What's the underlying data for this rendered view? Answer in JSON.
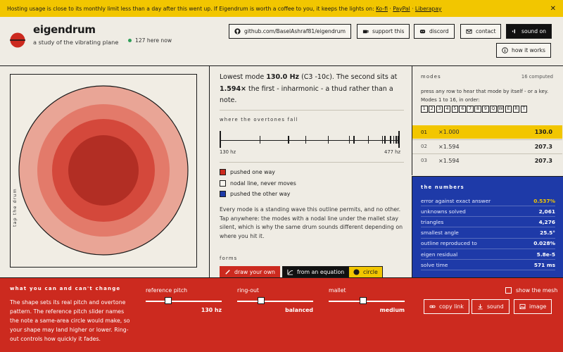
{
  "banner": {
    "message": "Hosting usage is close to its monthly limit less than a day after this went up. If Eigendrum is worth a coffee to you, it keeps the lights on:",
    "links": [
      "Ko-fi",
      "PayPal",
      "Liberapay"
    ],
    "separator": "·",
    "close": "✕"
  },
  "header": {
    "title": "eigendrum",
    "subtitle": "a study of the vibrating plane",
    "online": "127 here now",
    "buttons": {
      "github": "github.com/BaselAshraf81/eigendrum",
      "support": "support this",
      "discord": "discord",
      "contact": "contact",
      "sound": "sound on",
      "how": "how it works"
    }
  },
  "drum": {
    "tap_label": "tap the drum",
    "ring_colors": [
      "#e9a596",
      "#e37a6a",
      "#d4483b",
      "#b22e24"
    ]
  },
  "summary": {
    "p1": "Lowest mode ",
    "freq": "130.0 Hz",
    "p2": " (C3 -10c). The second sits at ",
    "ratio": "1.594×",
    "p3": " the first - inharmonic - a thud rather than a note."
  },
  "overtones": {
    "title": "where the overtones fall",
    "min_label": "130 hz",
    "max_label": "477 hz",
    "min_hz": 130,
    "max_hz": 477,
    "marks_hz": [
      130,
      207.3,
      207.3,
      263,
      296,
      340,
      381,
      390,
      418,
      445,
      450,
      461,
      467,
      472,
      475,
      477
    ],
    "legend": [
      {
        "label": "pushed one way",
        "color": "#cc2a1f"
      },
      {
        "label": "nodal line, never moves",
        "color": "#f7f5ef"
      },
      {
        "label": "pushed the other way",
        "color": "#1e3aa8"
      }
    ],
    "paragraph": "Every mode is a standing wave this outline permits, and no other. Tap anywhere: the modes with a nodal line under the mallet stay silent, which is why the same drum sounds different depending on where you hit it."
  },
  "forms": {
    "title": "forms",
    "draw": "draw your own",
    "equation": "from an equation",
    "circle": "circle"
  },
  "modes": {
    "title": "modes",
    "count": "16 computed",
    "hint": "press any row to hear that mode by itself - or a key. Modes 1 to 16, in order:",
    "keys": [
      "1",
      "2",
      "3",
      "4",
      "5",
      "6",
      "7",
      "8",
      "9",
      "Q",
      "W",
      "E",
      "R",
      "T"
    ],
    "rows": [
      {
        "n": "01",
        "ratio": "×1.000",
        "hz": "130.0",
        "selected": true
      },
      {
        "n": "02",
        "ratio": "×1.594",
        "hz": "207.3",
        "selected": false
      },
      {
        "n": "03",
        "ratio": "×1.594",
        "hz": "207.3",
        "selected": false
      }
    ]
  },
  "numbers": {
    "title": "the numbers",
    "stats": [
      {
        "k": "error against exact answer",
        "v": "0.537%",
        "hi": true
      },
      {
        "k": "unknowns solved",
        "v": "2,061",
        "hi": false
      },
      {
        "k": "triangles",
        "v": "4,276",
        "hi": false
      },
      {
        "k": "smallest angle",
        "v": "25.5°",
        "hi": false
      },
      {
        "k": "outline reproduced to",
        "v": "0.028%",
        "hi": false
      },
      {
        "k": "eigen residual",
        "v": "5.8e-5",
        "hi": false
      },
      {
        "k": "solve time",
        "v": "571 ms",
        "hi": false
      }
    ]
  },
  "footer": {
    "title": "what you can and can't change",
    "paragraph": "The shape sets its real pitch and overtone pattern. The reference pitch slider names the note a same-area circle would make, so your shape may land higher or lower. Ring-out controls how quickly it fades.",
    "reference_label": "reference pitch",
    "reference_value": "130 hz",
    "reference_level": 0.28,
    "ringout_label": "ring-out",
    "ringout_value": "balanced",
    "ringout_level": 0.3,
    "mallet_label": "mallet",
    "mallet_value": "medium",
    "mallet_level": 0.45,
    "mesh": "show the mesh",
    "copy_link": "copy link",
    "sound": "sound",
    "image": "image"
  },
  "colors": {
    "banner": "#f2c600",
    "red": "#cc2a1f",
    "blue": "#1e3aa8",
    "ink": "#1a1a1a"
  }
}
